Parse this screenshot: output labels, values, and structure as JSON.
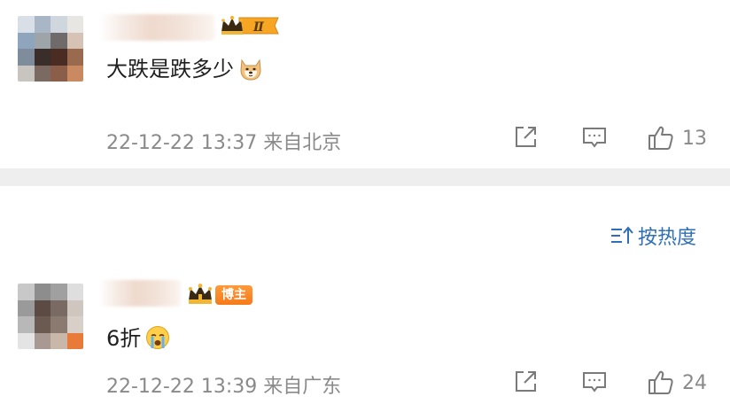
{
  "comments": [
    {
      "text": "大跌是跌多少",
      "emoji": "doge-emoji",
      "badge": "Ⅱ",
      "timestamp": "22-12-22 13:37",
      "location": "来自北京",
      "likes": "13"
    },
    {
      "text": "6折",
      "emoji": "crying-emoji",
      "badge": "博主",
      "timestamp": "22-12-22 13:39",
      "location": "来自广东",
      "likes": "24"
    }
  ],
  "sort": {
    "label": "按热度"
  },
  "colors": {
    "accent": "#2f6fb5",
    "badge_orange": "#f57a1a",
    "meta_gray": "#8a8a8a",
    "divider": "#eeeeee"
  }
}
